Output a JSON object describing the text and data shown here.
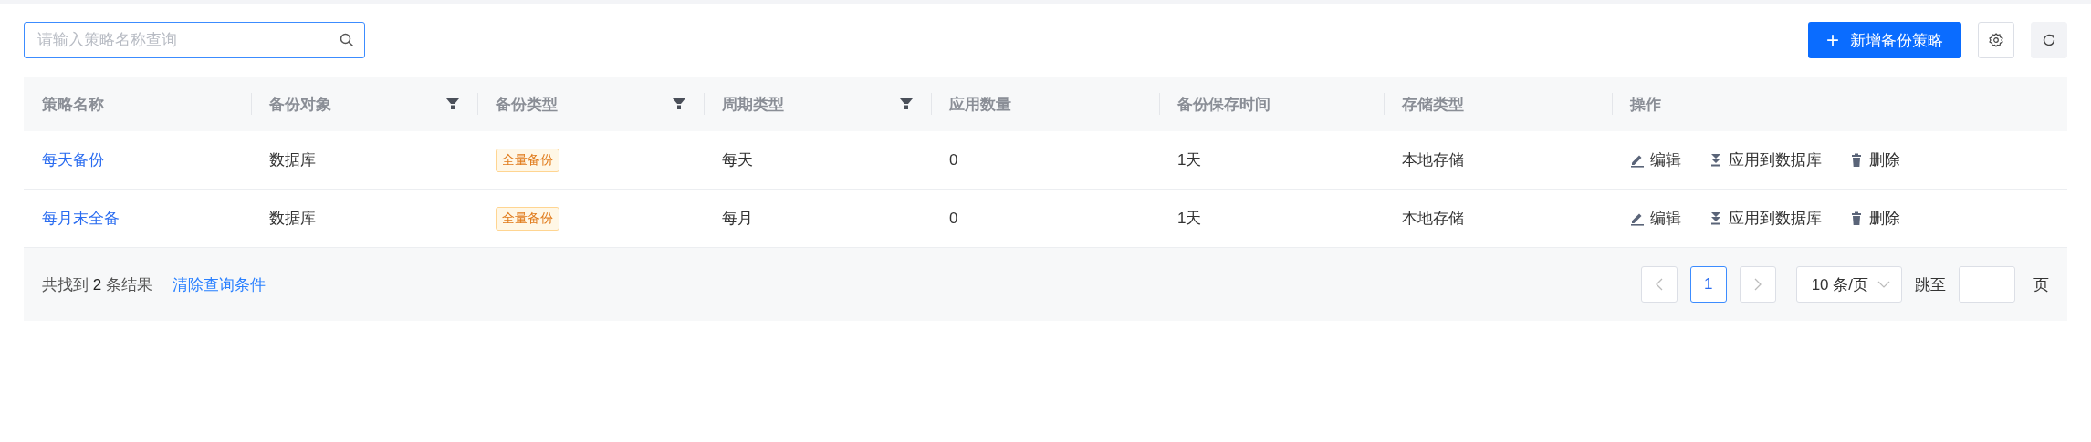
{
  "search": {
    "placeholder": "请输入策略名称查询"
  },
  "toolbar": {
    "add_button": "新增备份策略",
    "add_icon": "+"
  },
  "table": {
    "columns": [
      {
        "label": "策略名称",
        "filter": false
      },
      {
        "label": "备份对象",
        "filter": true
      },
      {
        "label": "备份类型",
        "filter": true
      },
      {
        "label": "周期类型",
        "filter": true
      },
      {
        "label": "应用数量",
        "filter": false
      },
      {
        "label": "备份保存时间",
        "filter": false
      },
      {
        "label": "存储类型",
        "filter": false
      },
      {
        "label": "操作",
        "filter": false
      }
    ],
    "rows": [
      {
        "name": "每天备份",
        "target": "数据库",
        "type": "全量备份",
        "cycle": "每天",
        "count": "0",
        "retention": "1天",
        "storage": "本地存储",
        "actions": [
          "编辑",
          "应用到数据库",
          "删除"
        ]
      },
      {
        "name": "每月末全备",
        "target": "数据库",
        "type": "全量备份",
        "cycle": "每月",
        "count": "0",
        "retention": "1天",
        "storage": "本地存储",
        "actions": [
          "编辑",
          "应用到数据库",
          "删除"
        ]
      }
    ]
  },
  "footer": {
    "result_prefix": "共找到",
    "result_count": "2",
    "result_suffix": "条结果",
    "clear_link": "清除查询条件",
    "pages": [
      {
        "label": "1",
        "selected": true
      }
    ],
    "page_size": "10 条/页",
    "jump_label": "跳至",
    "page_unit": "页"
  }
}
